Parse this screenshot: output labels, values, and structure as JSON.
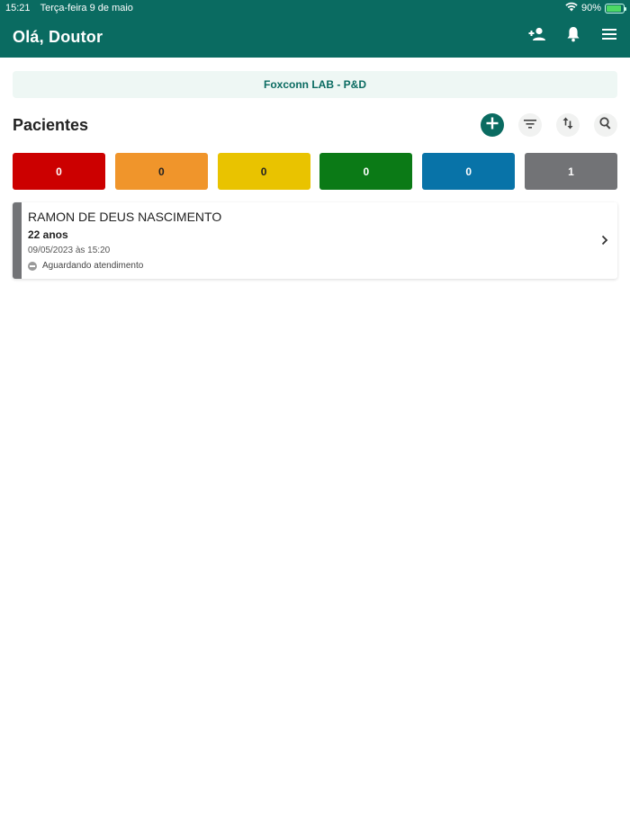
{
  "status_bar": {
    "time": "15:21",
    "date": "Terça-feira 9 de maio",
    "battery": "90%",
    "battery_level": 0.9
  },
  "header": {
    "greeting": "Olá, Doutor",
    "actions": [
      {
        "icon": "add-person-icon"
      },
      {
        "icon": "bell-icon"
      },
      {
        "icon": "menu-icon"
      }
    ]
  },
  "lab": {
    "name": "Foxconn LAB - P&D"
  },
  "patients": {
    "title": "Pacientes",
    "tools": [
      "add-icon",
      "filter-icon",
      "sort-icon",
      "search-icon"
    ]
  },
  "counters": [
    {
      "label": "0",
      "color": "#cc0000",
      "text_color": "#ffffff"
    },
    {
      "label": "0",
      "color": "#f0952b",
      "text_color": "#222222"
    },
    {
      "label": "0",
      "color": "#e9c300",
      "text_color": "#222222"
    },
    {
      "label": "0",
      "color": "#0b7a16",
      "text_color": "#ffffff"
    },
    {
      "label": "0",
      "color": "#0873a8",
      "text_color": "#ffffff"
    },
    {
      "label": "1",
      "color": "#727376",
      "text_color": "#ffffff"
    }
  ],
  "patient_list": [
    {
      "name": "RAMON DE DEUS NASCIMENTO",
      "age": "22 anos",
      "datetime": "09/05/2023 às 15:20",
      "status": "Aguardando atendimento",
      "accent_color": "#727376"
    }
  ],
  "colors": {
    "primary": "#0a6b61",
    "banner_bg": "#eef7f4"
  }
}
